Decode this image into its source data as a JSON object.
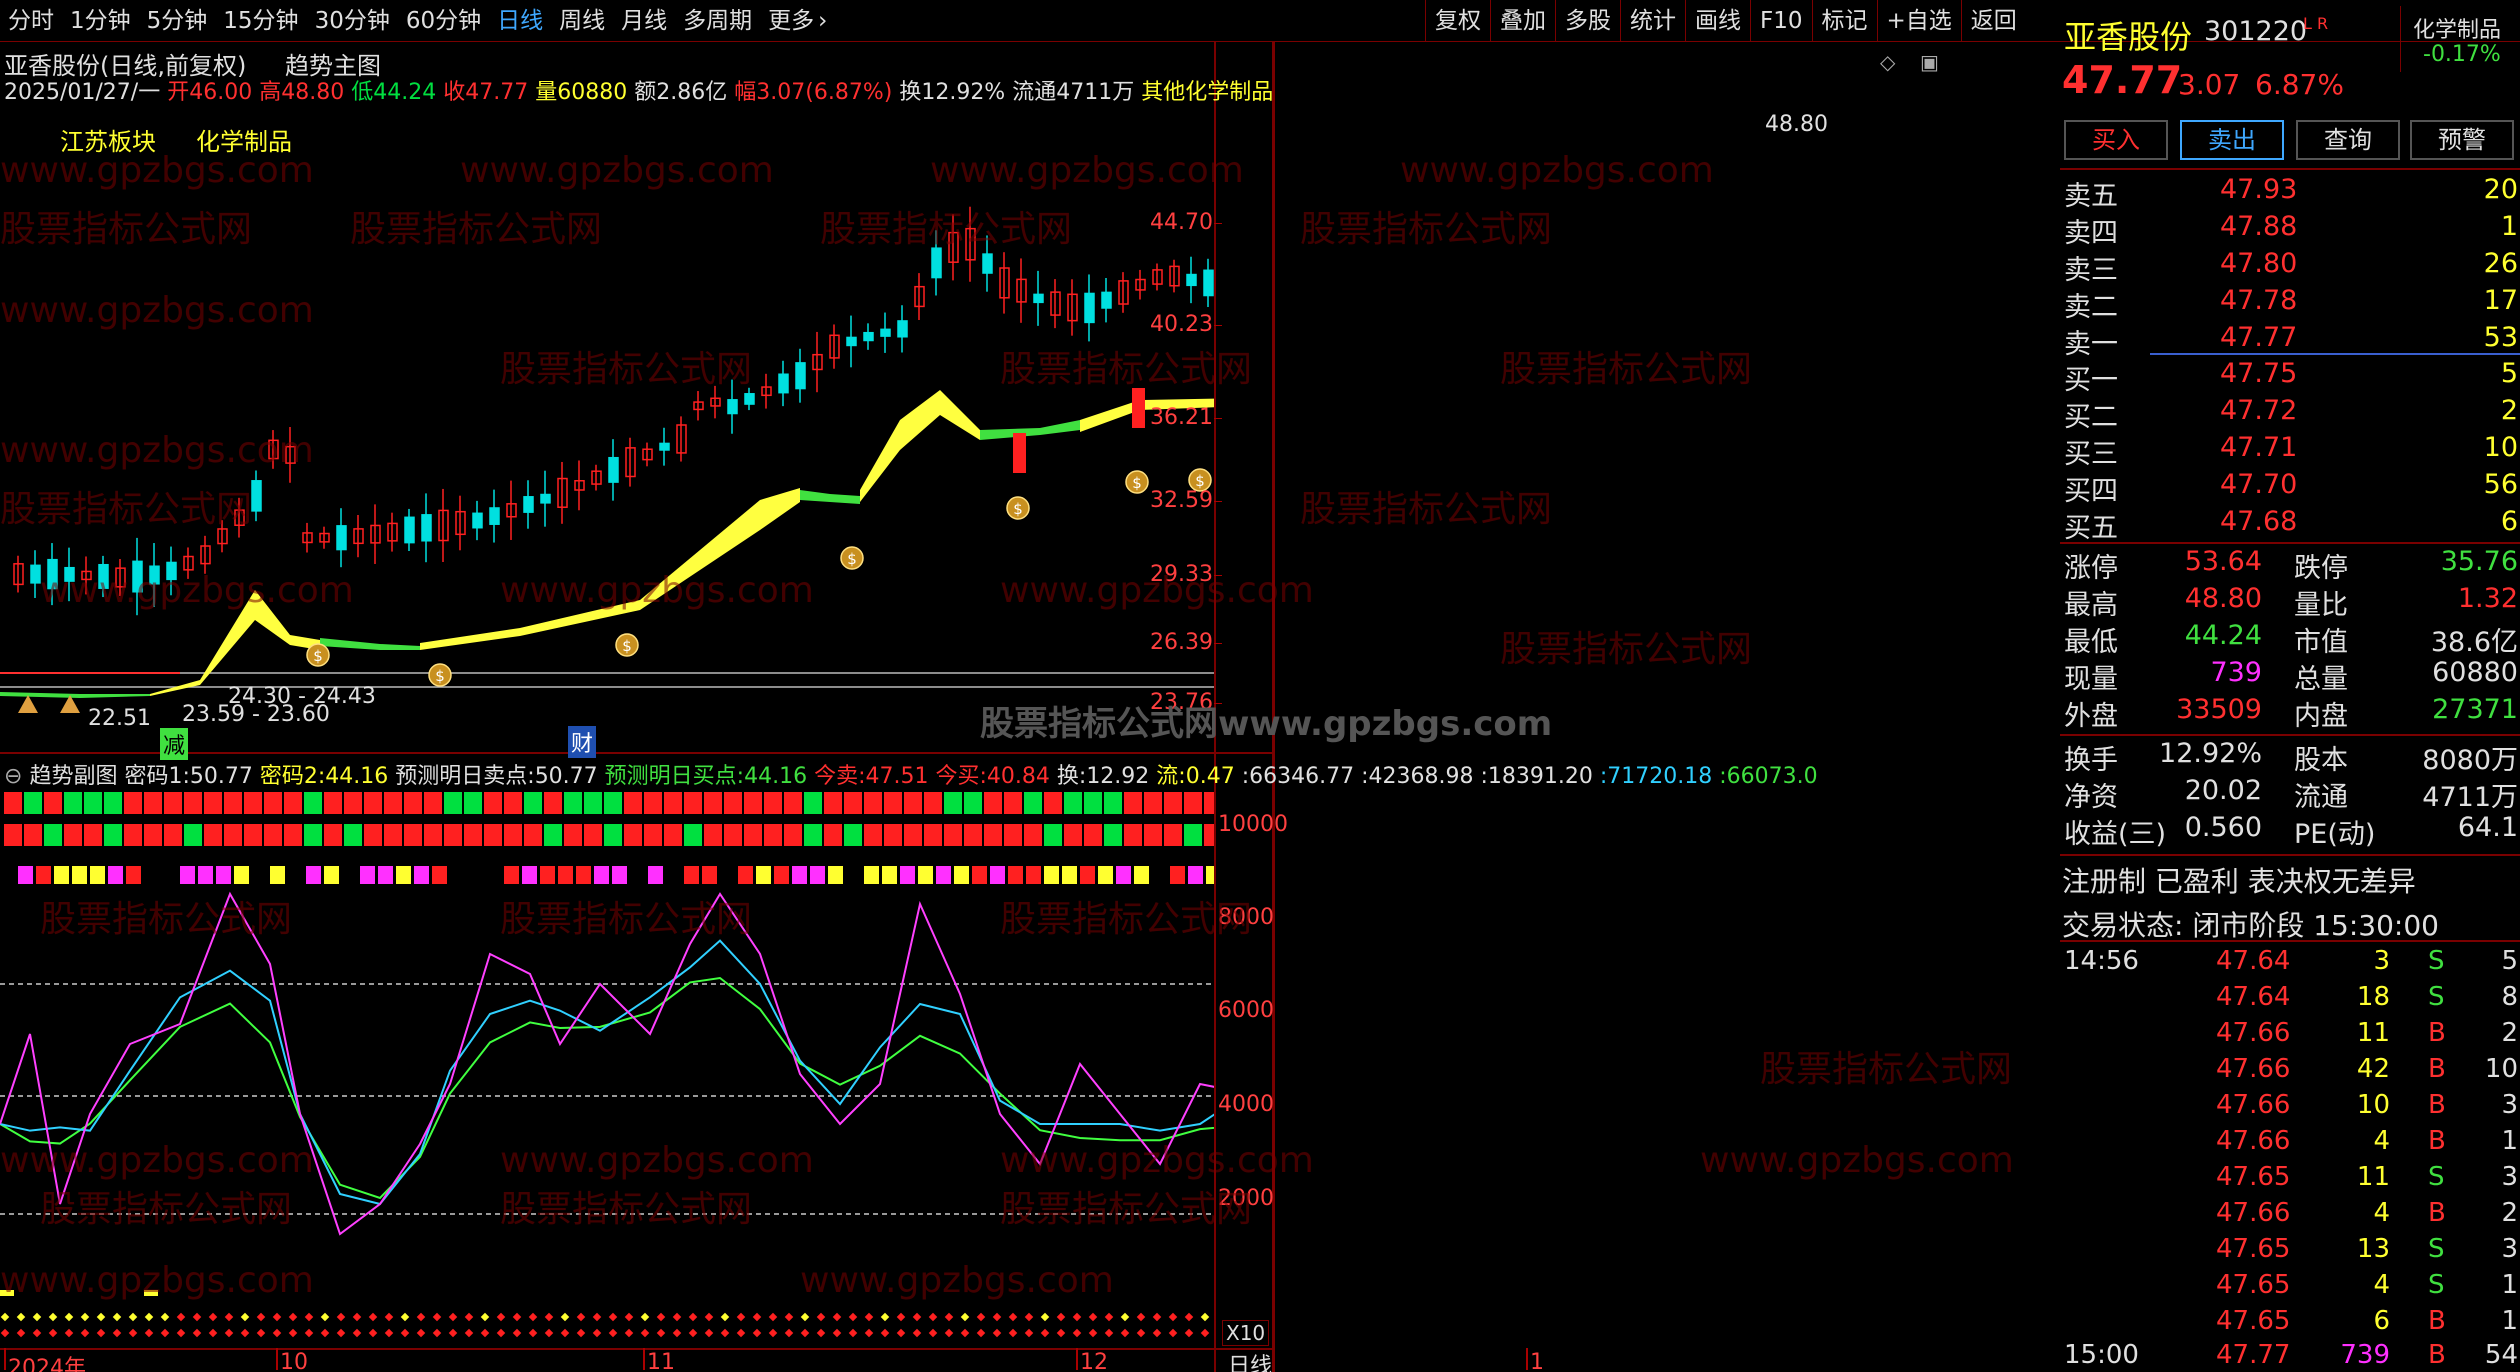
{
  "toolbar": {
    "periods": [
      "分时",
      "1分钟",
      "5分钟",
      "15分钟",
      "30分钟",
      "60分钟",
      "日线",
      "周线",
      "月线",
      "多周期",
      "更多"
    ],
    "active_period": "日线",
    "buttons": [
      "复权",
      "叠加",
      "多股",
      "统计",
      "画线",
      "F10",
      "标记",
      "+自选",
      "返回"
    ]
  },
  "chart_header": {
    "stock_title": "亚香股份(日线,前复权)",
    "main_indicator": "趋势主图",
    "date": "2025/01/27/一",
    "open_label": "开",
    "open": "46.00",
    "high_label": "高",
    "high": "48.80",
    "low_label": "低",
    "low": "44.24",
    "close_label": "收",
    "close": "47.77",
    "vol_label": "量",
    "vol": "60880",
    "amount_label": "额",
    "amount": "2.86亿",
    "change_label": "幅",
    "change": "3.07(6.87%)",
    "turnover_label": "换",
    "turnover": "12.92%",
    "float_label": "流通",
    "float": "4711万",
    "industry": "其他化学制品",
    "tag1": "江苏板块",
    "tag2": "化学制品"
  },
  "main_chart": {
    "y_ticks": [
      "44.70",
      "40.23",
      "36.21",
      "32.59",
      "29.33",
      "26.39",
      "23.76"
    ],
    "high_mark": "48.80",
    "low_mark": "22.51",
    "range_label": "24.30 - 24.43",
    "range_label2": "23.59 - 23.60",
    "jian_label": "减",
    "cai_label": "财",
    "colors": {
      "up": "#ff2020",
      "down": "#00e0e0",
      "band_up": "#ffff40",
      "band_down": "#40e040"
    }
  },
  "sub_chart": {
    "title": "趋势副图",
    "m1_label": "密码1:",
    "m1": "50.77",
    "m2_label": "密码2:",
    "m2": "44.16",
    "sell_label": "预测明日卖点:",
    "sell": "50.77",
    "buy_label": "预测明日买点:",
    "buy": "44.16",
    "today_sell_label": "今卖:",
    "today_sell": "47.51",
    "today_buy_label": "今买:",
    "today_buy": "40.84",
    "huan_label": "换:",
    "huan": "12.92",
    "liu_label": "流:",
    "liu": "0.47",
    "v1": ":66346.77",
    "v2": ":42368.98",
    "v3": ":18391.20",
    "v4": ":71720.18",
    "v5": ":66073.0",
    "y_ticks": [
      "10000",
      "8000",
      "6000",
      "4000",
      "2000"
    ],
    "scale_label": "X10"
  },
  "x_axis": {
    "labels": [
      "2024年",
      "10",
      "11",
      "12",
      "1"
    ],
    "period_label": "日线"
  },
  "quote": {
    "name": "亚香股份",
    "code": "301220",
    "flags": "L R",
    "sector": "化学制品",
    "sector_change": "-0.17%",
    "price": "47.77",
    "change": "3.07",
    "pct": "6.87%",
    "buttons": [
      "买入",
      "卖出",
      "查询",
      "预警"
    ],
    "asks": [
      {
        "label": "卖五",
        "price": "47.93",
        "vol": "20"
      },
      {
        "label": "卖四",
        "price": "47.88",
        "vol": "1"
      },
      {
        "label": "卖三",
        "price": "47.80",
        "vol": "26"
      },
      {
        "label": "卖二",
        "price": "47.78",
        "vol": "17"
      },
      {
        "label": "卖一",
        "price": "47.77",
        "vol": "53"
      }
    ],
    "bids": [
      {
        "label": "买一",
        "price": "47.75",
        "vol": "5"
      },
      {
        "label": "买二",
        "price": "47.72",
        "vol": "2"
      },
      {
        "label": "买三",
        "price": "47.71",
        "vol": "10"
      },
      {
        "label": "买四",
        "price": "47.70",
        "vol": "56"
      },
      {
        "label": "买五",
        "price": "47.68",
        "vol": "6"
      }
    ],
    "stats": [
      {
        "l1": "涨停",
        "v1": "53.64",
        "l2": "跌停",
        "v2": "35.76"
      },
      {
        "l1": "最高",
        "v1": "48.80",
        "l2": "量比",
        "v2": "1.32"
      },
      {
        "l1": "最低",
        "v1": "44.24",
        "l2": "市值",
        "v2": "38.6亿"
      },
      {
        "l1": "现量",
        "v1": "739",
        "l2": "总量",
        "v2": "60880"
      },
      {
        "l1": "外盘",
        "v1": "33509",
        "l2": "内盘",
        "v2": "27371"
      }
    ],
    "fin": [
      {
        "l1": "换手",
        "v1": "12.92%",
        "l2": "股本",
        "v2": "8080万"
      },
      {
        "l1": "净资",
        "v1": "20.02",
        "l2": "流通",
        "v2": "4711万"
      },
      {
        "l1": "收益(三)",
        "v1": "0.560",
        "l2": "PE(动)",
        "v2": "64.1"
      }
    ],
    "reg": "注册制 已盈利 表决权无差异",
    "status": "交易状态: 闭市阶段 15:30:00"
  },
  "deals": [
    {
      "time": "14:56",
      "price": "47.64",
      "vol": "3",
      "side": "S",
      "n": "5"
    },
    {
      "time": "",
      "price": "47.64",
      "vol": "18",
      "side": "S",
      "n": "8"
    },
    {
      "time": "",
      "price": "47.66",
      "vol": "11",
      "side": "B",
      "n": "2"
    },
    {
      "time": "",
      "price": "47.66",
      "vol": "42",
      "side": "B",
      "n": "10"
    },
    {
      "time": "",
      "price": "47.66",
      "vol": "10",
      "side": "B",
      "n": "3"
    },
    {
      "time": "",
      "price": "47.66",
      "vol": "4",
      "side": "B",
      "n": "1"
    },
    {
      "time": "",
      "price": "47.65",
      "vol": "11",
      "side": "S",
      "n": "3"
    },
    {
      "time": "",
      "price": "47.66",
      "vol": "4",
      "side": "B",
      "n": "2"
    },
    {
      "time": "",
      "price": "47.65",
      "vol": "13",
      "side": "S",
      "n": "3"
    },
    {
      "time": "",
      "price": "47.65",
      "vol": "4",
      "side": "S",
      "n": "1"
    },
    {
      "time": "",
      "price": "47.65",
      "vol": "6",
      "side": "B",
      "n": "1"
    },
    {
      "time": "15:00",
      "price": "47.77",
      "vol": "739",
      "side": "B",
      "n": "54"
    }
  ]
}
